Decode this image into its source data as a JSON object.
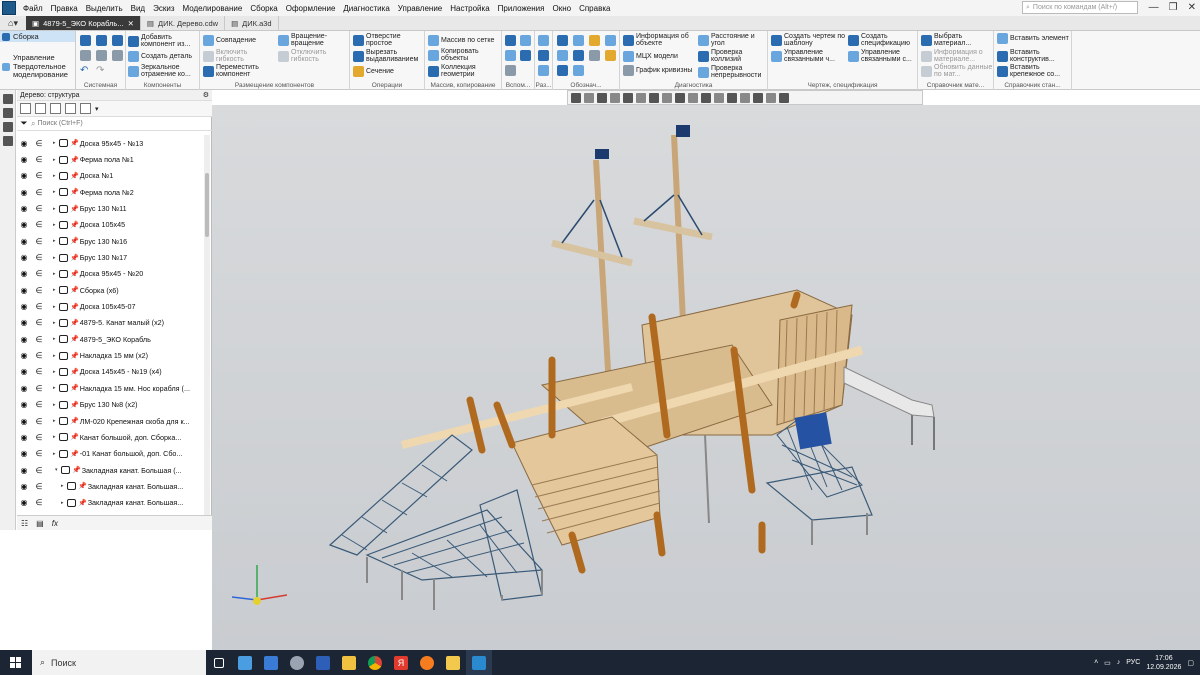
{
  "menubar": {
    "items": [
      "Файл",
      "Правка",
      "Выделить",
      "Вид",
      "Эскиз",
      "Моделирование",
      "Сборка",
      "Оформление",
      "Диагностика",
      "Управление",
      "Настройка",
      "Приложения",
      "Окно",
      "Справка"
    ],
    "search_placeholder": "Поиск по командам (Alt+/)"
  },
  "tabs": [
    {
      "label": "4879-5_ЭКО Корабль..."
    },
    {
      "label": "ДИК. Дерево.cdw"
    },
    {
      "label": "ДИК.a3d"
    }
  ],
  "ribbon": {
    "side": [
      "Сборка",
      "Управление",
      "Твердотельное моделирование"
    ],
    "groups": {
      "system": "Системная",
      "components": "Компоненты",
      "placement": "Размещение компонентов",
      "operations": "Операции",
      "array": "Массив, копирование",
      "aux": "Вспом...",
      "sizes": "Раз...",
      "desig": "Обознач...",
      "diag": "Диагностика",
      "drawing": "Чертеж, спецификация",
      "refmat": "Справочник мате...",
      "refstd": "Справочник стан..."
    },
    "buttons": {
      "add_component": "Добавить компонент из...",
      "create_part": "Создать деталь",
      "mirror": "Зеркальное отражение ко...",
      "coincidence": "Совпадение",
      "rotation": "Вращение-вращение",
      "enable_flex": "Включить гибкость",
      "move_comp": "Переместить компонент",
      "disable_flex": "Отключить гибкость",
      "hole": "Отверстие простое",
      "cut_extrude": "Вырезать выдавливанием",
      "section": "Сечение",
      "grid_array": "Массив по сетке",
      "copy_obj": "Копировать объекты",
      "geom_coll": "Коллекция геометрии",
      "obj_info": "Информация об объекте",
      "mcs": "МЦХ модели",
      "curv": "График кривизны",
      "dist": "Расстояние и угол",
      "collisions": "Проверка коллизий",
      "continuity": "Проверка непрерывности",
      "create_drawing": "Создать чертеж по шаблону",
      "manage_linked": "Управление связанными ч...",
      "create_spec": "Создать спецификацию",
      "manage_linked2": "Управление связанными с...",
      "choose_material": "Выбрать материал...",
      "mat_info": "Информация о материале...",
      "update_mat": "Обновить данные по мат...",
      "insert_elem": "Вставить элемент",
      "insert_constr": "Вставить конструктив...",
      "insert_fast": "Вставить крепежное со..."
    }
  },
  "panel": {
    "title": "Дерево: структура",
    "filter_placeholder": "Поиск (Ctrl+F)",
    "tree": [
      {
        "label": "Доска 95х45 - №13"
      },
      {
        "label": "Ферма пола №1"
      },
      {
        "label": "Доска №1"
      },
      {
        "label": "Ферма пола №2"
      },
      {
        "label": "Брус 130 №11"
      },
      {
        "label": "Доска 105х45"
      },
      {
        "label": "Брус 130 №16"
      },
      {
        "label": "Брус 130 №17"
      },
      {
        "label": "Доска 95х45 - №20"
      },
      {
        "label": "Сборка (х6)"
      },
      {
        "label": "Доска 105х45-07"
      },
      {
        "label": "4879-5. Канат малый (х2)"
      },
      {
        "label": "4879-5_ЭКО Корабль"
      },
      {
        "label": "Накладка 15 мм (х2)"
      },
      {
        "label": "Доска 145х45 - №19 (х4)"
      },
      {
        "label": "Накладка 15 мм. Нос корабля (..."
      },
      {
        "label": "Брус 130 №8 (х2)"
      },
      {
        "label": "ЛМ-020 Крепежная скоба для к..."
      },
      {
        "label": "Канат большой, доп. Сборка..."
      },
      {
        "label": "-01 Канат большой, доп. Сбо..."
      },
      {
        "label": "Закладная канат. Большая (..."
      },
      {
        "label": "Закладная канат. Большая..."
      },
      {
        "label": "Закладная канат. Большая..."
      }
    ]
  },
  "taskbar": {
    "search_label": "Поиск",
    "lang": "РУС",
    "time": "17:06",
    "date": "12.09.2026"
  },
  "colors": {
    "accent": "#2b6cb0",
    "wood": "#d9b98a",
    "post": "#b06a1f",
    "net": "#3a5a78"
  }
}
